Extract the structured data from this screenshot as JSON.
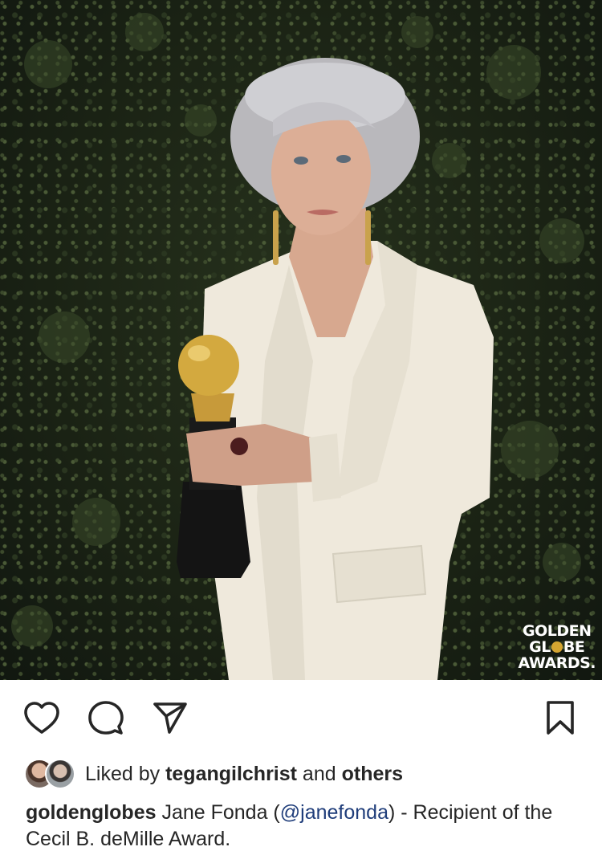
{
  "photo": {
    "watermark": {
      "line1": "GOLDEN",
      "line2a": "GL",
      "line2b": "BE",
      "line3": "AWARDS."
    }
  },
  "actions": {
    "like_icon": "heart-icon",
    "comment_icon": "comment-icon",
    "share_icon": "paper-plane-icon",
    "save_icon": "bookmark-icon"
  },
  "likes": {
    "prefix": "Liked by ",
    "user": "tegangilchrist",
    "middle": " and ",
    "others": "others"
  },
  "caption": {
    "username": "goldenglobes",
    "text_before": " Jane Fonda (",
    "mention": "@janefonda",
    "text_after": ") - Recipient of the Cecil B. deMille Award."
  },
  "colors": {
    "mention": "#1f3d7a",
    "text": "#262626",
    "globe_gold": "#d4a531"
  }
}
